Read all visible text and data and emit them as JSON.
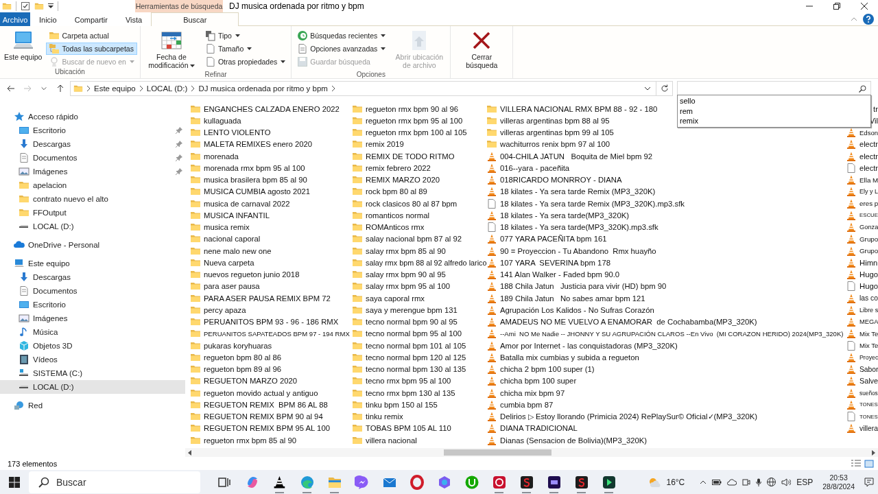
{
  "window": {
    "title": "DJ musica ordenada por ritmo y bpm"
  },
  "ribbon": {
    "context_tab": "Herramientas de búsqueda",
    "tabs": [
      {
        "label": "Archivo",
        "kind": "file",
        "selected": false
      },
      {
        "label": "Inicio",
        "kind": "plain",
        "selected": false
      },
      {
        "label": "Compartir",
        "kind": "plain",
        "selected": false
      },
      {
        "label": "Vista",
        "kind": "plain",
        "selected": false
      },
      {
        "label": "Buscar",
        "kind": "context",
        "selected": true
      }
    ],
    "groups": [
      {
        "title": "Ubicación",
        "items": [
          {
            "label": "Este equipo",
            "kind": "large",
            "selected": false,
            "disabled": false,
            "dropdown": false
          },
          {
            "label": "Carpeta actual",
            "kind": "small",
            "selected": false,
            "disabled": false,
            "dropdown": false
          },
          {
            "label": "Todas las subcarpetas",
            "kind": "small",
            "selected": true,
            "disabled": false,
            "dropdown": false
          },
          {
            "label": "Buscar de nuevo en",
            "kind": "small",
            "selected": false,
            "disabled": true,
            "dropdown": true
          }
        ]
      },
      {
        "title": "Refinar",
        "items": [
          {
            "label": "Fecha de modificación",
            "kind": "large",
            "selected": false,
            "disabled": false,
            "dropdown": true
          },
          {
            "label": "Tipo",
            "kind": "small",
            "selected": false,
            "disabled": false,
            "dropdown": true
          },
          {
            "label": "Tamaño",
            "kind": "small",
            "selected": false,
            "disabled": false,
            "dropdown": true
          },
          {
            "label": "Otras propiedades",
            "kind": "small",
            "selected": false,
            "disabled": false,
            "dropdown": true
          }
        ]
      },
      {
        "title": "Opciones",
        "items": [
          {
            "label": "Búsquedas recientes",
            "kind": "small",
            "selected": false,
            "disabled": false,
            "dropdown": true
          },
          {
            "label": "Opciones avanzadas",
            "kind": "small",
            "selected": false,
            "disabled": false,
            "dropdown": true
          },
          {
            "label": "Guardar búsqueda",
            "kind": "small",
            "selected": false,
            "disabled": true,
            "dropdown": false
          },
          {
            "label": "Abrir ubicación de archivo",
            "kind": "large",
            "selected": false,
            "disabled": true,
            "dropdown": false
          }
        ]
      },
      {
        "items": [
          {
            "label": "Cerrar búsqueda",
            "kind": "large",
            "selected": false,
            "disabled": false,
            "dropdown": false
          }
        ]
      }
    ]
  },
  "address_bar": {
    "path": [
      "Este equipo",
      "LOCAL (D:)",
      "DJ musica ordenada por ritmo y bpm"
    ]
  },
  "search": {
    "suggestions": [
      "sello",
      "rem",
      "remix"
    ]
  },
  "navigation": [
    {
      "label": "Acceso rápido",
      "kind": "star",
      "selected": false,
      "children": [
        {
          "label": "Escritorio",
          "kind": "desktop",
          "pinned": true,
          "selected": false
        },
        {
          "label": "Descargas",
          "kind": "download",
          "pinned": true,
          "selected": false
        },
        {
          "label": "Documentos",
          "kind": "documents",
          "pinned": true,
          "selected": false
        },
        {
          "label": "Imágenes",
          "kind": "pictures",
          "pinned": true,
          "selected": false
        },
        {
          "label": "apelacion",
          "kind": "folder",
          "pinned": false,
          "selected": false
        },
        {
          "label": "contrato nuevo el alto",
          "kind": "folder",
          "pinned": false,
          "selected": false
        },
        {
          "label": "FFOutput",
          "kind": "folder",
          "pinned": false,
          "selected": false
        },
        {
          "label": "LOCAL (D:)",
          "kind": "drive",
          "pinned": false,
          "selected": false
        }
      ]
    },
    {
      "label": "OneDrive - Personal",
      "kind": "cloud",
      "selected": false
    },
    {
      "label": "Este equipo",
      "kind": "pc",
      "selected": false,
      "children": [
        {
          "label": "Descargas",
          "kind": "download",
          "selected": false
        },
        {
          "label": "Documentos",
          "kind": "documents",
          "selected": false
        },
        {
          "label": "Escritorio",
          "kind": "desktop",
          "selected": false
        },
        {
          "label": "Imágenes",
          "kind": "pictures",
          "selected": false
        },
        {
          "label": "Música",
          "kind": "music",
          "selected": false
        },
        {
          "label": "Objetos 3D",
          "kind": "objects",
          "selected": false
        },
        {
          "label": "Vídeos",
          "kind": "video",
          "selected": false
        },
        {
          "label": "SISTEMA (C:)",
          "kind": "system-drive",
          "selected": false
        },
        {
          "label": "LOCAL (D:)",
          "kind": "drive",
          "selected": true
        }
      ]
    },
    {
      "label": "Red",
      "kind": "network",
      "selected": false
    }
  ],
  "files": [
    {
      "name": "ENGANCHES CALZADA ENERO 2022",
      "kind": "folder"
    },
    {
      "name": "kullaguada",
      "kind": "folder"
    },
    {
      "name": "LENTO VIOLENTO",
      "kind": "folder"
    },
    {
      "name": "MALETA REMIXES enero 2020",
      "kind": "folder"
    },
    {
      "name": "morenada",
      "kind": "folder"
    },
    {
      "name": "morenada rmx bpm 95 al 100",
      "kind": "folder"
    },
    {
      "name": "musica brasilera bpm 85 al 90",
      "kind": "folder"
    },
    {
      "name": "MUSICA CUMBIA agosto 2021",
      "kind": "folder"
    },
    {
      "name": "musica de carnaval 2022",
      "kind": "folder"
    },
    {
      "name": "MUSICA INFANTIL",
      "kind": "folder"
    },
    {
      "name": "musica remix",
      "kind": "folder"
    },
    {
      "name": "nacional caporal",
      "kind": "folder"
    },
    {
      "name": "nene malo new one",
      "kind": "folder"
    },
    {
      "name": "Nueva carpeta",
      "kind": "folder"
    },
    {
      "name": "nuevos regueton junio 2018",
      "kind": "folder"
    },
    {
      "name": "para aser pausa",
      "kind": "folder"
    },
    {
      "name": "PARA ASER PAUSA REMIX BPM 72",
      "kind": "folder"
    },
    {
      "name": "percy apaza",
      "kind": "folder"
    },
    {
      "name": "PERUANITOS BPM 93 - 96 - 186 RMX",
      "kind": "folder"
    },
    {
      "name": "PERUANITOS SAPATEADOS BPM 97 - 194 RMX",
      "kind": "folder"
    },
    {
      "name": "pukaras koryhuaras",
      "kind": "folder"
    },
    {
      "name": "regueton bpm 80 al 86",
      "kind": "folder"
    },
    {
      "name": "regueton bpm 89 al 96",
      "kind": "folder"
    },
    {
      "name": "REGUETON MARZO 2020",
      "kind": "folder"
    },
    {
      "name": "regueton movido actual y antiguo",
      "kind": "folder"
    },
    {
      "name": "REGUETON REMIX  BPM 86 AL 88",
      "kind": "folder"
    },
    {
      "name": "REGUETON REMIX BPM 90 al 94",
      "kind": "folder"
    },
    {
      "name": "REGUETON REMIX BPM 95 AL 100",
      "kind": "folder"
    },
    {
      "name": "regueton rmx bpm 85 al 90",
      "kind": "folder"
    },
    {
      "name": "regueton rmx bpm 90 al 96",
      "kind": "folder"
    },
    {
      "name": "regueton rmx bpm 95 al 100",
      "kind": "folder"
    },
    {
      "name": "regueton rmx bpm 100 al 105",
      "kind": "folder"
    },
    {
      "name": "remix 2019",
      "kind": "folder"
    },
    {
      "name": "REMIX DE TODO RITMO",
      "kind": "folder"
    },
    {
      "name": "remix febrero 2022",
      "kind": "folder"
    },
    {
      "name": "REMIX MARZO 2020",
      "kind": "folder"
    },
    {
      "name": "rock bpm 80 al 89",
      "kind": "folder"
    },
    {
      "name": "rock clasicos 80 al 87 bpm",
      "kind": "folder"
    },
    {
      "name": "romanticos normal",
      "kind": "folder"
    },
    {
      "name": "ROMAnticos rmx",
      "kind": "folder"
    },
    {
      "name": "salay nacional bpm 87 al 92",
      "kind": "folder"
    },
    {
      "name": "salay rmx bpm 85 al 90",
      "kind": "folder"
    },
    {
      "name": "salay rmx bpm 88 al 92 alfredo larico",
      "kind": "folder"
    },
    {
      "name": "salay rmx bpm 90 al 95",
      "kind": "folder"
    },
    {
      "name": "salay rmx bpm 95 al 100",
      "kind": "folder"
    },
    {
      "name": "saya caporal rmx",
      "kind": "folder"
    },
    {
      "name": "saya y merengue bpm 131",
      "kind": "folder"
    },
    {
      "name": "tecno normal bpm 90 al 95",
      "kind": "folder"
    },
    {
      "name": "tecno normal bpm 95 al 100",
      "kind": "folder"
    },
    {
      "name": "tecno normal bpm 101 al 105",
      "kind": "folder"
    },
    {
      "name": "tecno normal bpm 120 al 125",
      "kind": "folder"
    },
    {
      "name": "tecno normal bpm 130 al 135",
      "kind": "folder"
    },
    {
      "name": "tecno rmx bpm 95 al 100",
      "kind": "folder"
    },
    {
      "name": "tecno rmx bpm 130 al 135",
      "kind": "folder"
    },
    {
      "name": "tinku bpm 150 al 155",
      "kind": "folder"
    },
    {
      "name": "tinku remix",
      "kind": "folder"
    },
    {
      "name": "TOBAS BPM 105 AL 110",
      "kind": "folder"
    },
    {
      "name": "villera nacional",
      "kind": "folder"
    },
    {
      "name": "VILLERA NACIONAL RMX BPM 88 - 92 - 180",
      "kind": "folder"
    },
    {
      "name": "villeras argentinas bpm 88 al 95",
      "kind": "folder"
    },
    {
      "name": "villeras argentinas bpm 99 al 105",
      "kind": "folder"
    },
    {
      "name": "wachiturros renix bpm 97 al 100",
      "kind": "folder"
    },
    {
      "name": "004-CHILA JATUN   Boquita de Miel bpm 92",
      "kind": "media"
    },
    {
      "name": "016--yara - paceñita",
      "kind": "media"
    },
    {
      "name": "018RICARDO MONRROY - DIANA",
      "kind": "media"
    },
    {
      "name": "18 kilates - Ya sera tarde Remix (MP3_320K)",
      "kind": "media"
    },
    {
      "name": "18 kilates - Ya sera tarde Remix (MP3_320K).mp3.sfk",
      "kind": "file"
    },
    {
      "name": "18 kilates - Ya sera tarde(MP3_320K)",
      "kind": "media"
    },
    {
      "name": "18 kilates - Ya sera tarde(MP3_320K).mp3.sfk",
      "kind": "file"
    },
    {
      "name": "077 YARA PACEÑITA bpm 161",
      "kind": "media"
    },
    {
      "name": "90 = Proyeccion - Tu Abandono  Rmx huayño",
      "kind": "media"
    },
    {
      "name": "107 YARA  SEVERINA bpm 178",
      "kind": "media"
    },
    {
      "name": "141 Alan Walker - Faded bpm 90.0",
      "kind": "media"
    },
    {
      "name": "188 Chila Jatun   Justicia para vivir (HD) bpm 90",
      "kind": "media"
    },
    {
      "name": "189 Chila Jatun   No sabes amar bpm 121",
      "kind": "media"
    },
    {
      "name": "Agrupación Los Kalidos - No Sufras Corazón",
      "kind": "media"
    },
    {
      "name": "AMADEUS NO ME VUELVO A ENAMORAR  de Cochabamba(MP3_320K)",
      "kind": "media"
    },
    {
      "name": "--Ami  NO Me Nadie -- JHONNY Y SU AGRUPACIÓN CLAROS --En Vivo  (MI CORAZON HERIDO) 2024(MP3_320K)",
      "kind": "media"
    },
    {
      "name": "Amor por Internet - las conquistadoras (MP3_320K)",
      "kind": "media"
    },
    {
      "name": "Batalla mix cumbias y subida a regueton",
      "kind": "media"
    },
    {
      "name": "chicha 2 bpm 100 super (1)",
      "kind": "media"
    },
    {
      "name": "chicha bpm 100 super",
      "kind": "media"
    },
    {
      "name": "chicha mix bpm 97",
      "kind": "media"
    },
    {
      "name": "cumbia bpm 87",
      "kind": "media"
    },
    {
      "name": "Delirios ▷ Estoy llorando (Primicia 2024) RePlaySur© Oficial✓(MP3_320K)",
      "kind": "media"
    },
    {
      "name": "DIANA TRADICIONAL",
      "kind": "media"
    },
    {
      "name": "Dianas (Sensacion de Bolivia)(MP3_320K)",
      "kind": "media"
    },
    {
      "name": "tr",
      "kind": "covered"
    },
    {
      "name": "Vil",
      "kind": "covered"
    },
    {
      "name": "Edson",
      "kind": "media"
    },
    {
      "name": "electr",
      "kind": "media"
    },
    {
      "name": "electr",
      "kind": "media"
    },
    {
      "name": "electr",
      "kind": "file"
    },
    {
      "name": "Ella M",
      "kind": "media"
    },
    {
      "name": "Ely y L",
      "kind": "media"
    },
    {
      "name": "eres p",
      "kind": "media"
    },
    {
      "name": "ESCUE",
      "kind": "media"
    },
    {
      "name": "Gonza",
      "kind": "media"
    },
    {
      "name": "Grupo",
      "kind": "media"
    },
    {
      "name": "Grupo",
      "kind": "media"
    },
    {
      "name": "Himn",
      "kind": "media"
    },
    {
      "name": "Hugo",
      "kind": "media"
    },
    {
      "name": "Hugo",
      "kind": "file"
    },
    {
      "name": "las co",
      "kind": "media"
    },
    {
      "name": "Libre s",
      "kind": "media"
    },
    {
      "name": "MEGA",
      "kind": "media"
    },
    {
      "name": "Mix Te",
      "kind": "media"
    },
    {
      "name": "Mix Te",
      "kind": "file"
    },
    {
      "name": "Proyec",
      "kind": "media"
    },
    {
      "name": "Sabor",
      "kind": "media"
    },
    {
      "name": "Salve",
      "kind": "media"
    },
    {
      "name": "sueños",
      "kind": "media"
    },
    {
      "name": "TONES",
      "kind": "media"
    },
    {
      "name": "TONES",
      "kind": "file"
    },
    {
      "name": "villera",
      "kind": "media"
    }
  ],
  "status_bar": {
    "count": "173 elementos"
  },
  "taskbar": {
    "search": "Buscar",
    "apps": [
      {
        "kind": "task-view",
        "running": false
      },
      {
        "kind": "copilot",
        "running": false
      },
      {
        "kind": "vlc",
        "running": true
      },
      {
        "kind": "edge",
        "running": true
      },
      {
        "kind": "explorer",
        "running": true
      },
      {
        "kind": "messenger",
        "running": false
      },
      {
        "kind": "mail",
        "running": false
      },
      {
        "kind": "opera",
        "running": false
      },
      {
        "kind": "m365",
        "running": false
      },
      {
        "kind": "u",
        "running": false
      },
      {
        "kind": "recorder",
        "running": true
      },
      {
        "kind": "s",
        "running": true
      },
      {
        "kind": "au",
        "running": true
      },
      {
        "kind": "s",
        "running": true
      },
      {
        "kind": "green",
        "running": true
      }
    ],
    "weather": "16°C",
    "language": "ESP",
    "time": "20:53",
    "date": "28/8/2024"
  }
}
